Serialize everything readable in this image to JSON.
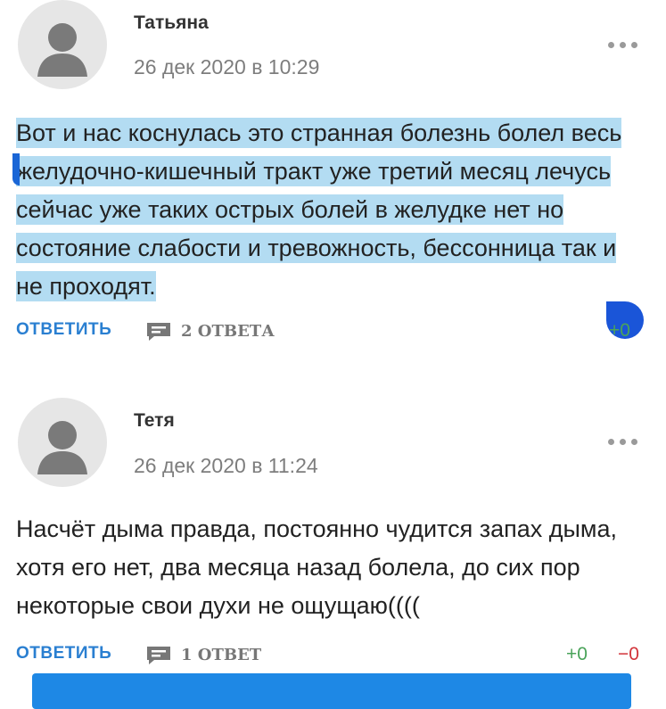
{
  "comments": [
    {
      "author": "Татьяна",
      "date": "26 дек 2020 в 10:29",
      "text": "Вот и нас коснулась это странная болезнь болел весь желудочно-кишечный тракт уже третий месяц лечусь сейчас уже таких острых болей в желудке нет но состояние слабости и тревожность, бессонница так и не проходят.",
      "reply_label": "ОТВЕТИТЬ",
      "replies_label": "2 ОТВЕТА",
      "upvotes": "+0",
      "selected": true
    },
    {
      "author": "Тетя",
      "date": "26 дек 2020 в 11:24",
      "text": "Насчёт дыма правда, постоянно чудится запах дыма, хотя его нет, два месяца назад болела, до сих пор некоторые свои духи не ощущаю((((",
      "reply_label": "ОТВЕТИТЬ",
      "replies_label": "1 ОТВЕТ",
      "upvotes": "+0",
      "downvotes": "−0",
      "selected": false
    }
  ],
  "colors": {
    "link_blue": "#2a7fd1",
    "selection": "#b3dcf2",
    "upvote_green": "#4aa35a",
    "downvote_red": "#d2343a",
    "bar_blue": "#1e88e5"
  },
  "icons": {
    "avatar": "user-silhouette-icon",
    "more": "more-dots-icon",
    "replies": "speech-bubble-icon"
  }
}
